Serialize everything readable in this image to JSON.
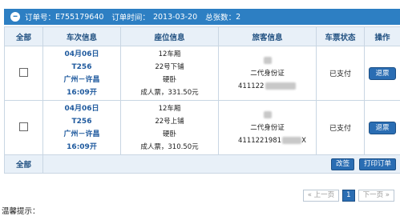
{
  "order": {
    "label_no": "订单号：",
    "no": "E755179640",
    "label_time": "订单时间：",
    "time": "2013-03-20",
    "label_count": "总张数：",
    "count": "2",
    "icon": "minus-circle-icon"
  },
  "columns": [
    "全部",
    "车次信息",
    "座位信息",
    "旅客信息",
    "车票状态",
    "操作"
  ],
  "rows": [
    {
      "date": "04月06日",
      "train": "T256",
      "route": "广州－许昌",
      "depart": "16:09开",
      "car": "12车厢",
      "seat": "22号下铺",
      "class": "硬卧",
      "fare": "成人票，331.50元",
      "id_type": "二代身份证",
      "id_no": "411122",
      "status": "已支付",
      "action": "退票"
    },
    {
      "date": "04月06日",
      "train": "T256",
      "route": "广州－许昌",
      "depart": "16:09开",
      "car": "12车厢",
      "seat": "22号上铺",
      "class": "硬卧",
      "fare": "成人票，310.50元",
      "id_type": "二代身份证",
      "id_no": "4111221981",
      "id_suffix": "X",
      "status": "已支付",
      "action": "退票"
    }
  ],
  "footer": {
    "all": "全部",
    "change": "改签",
    "print": "打印订单"
  },
  "pager": {
    "prev": "上一页",
    "current": "1",
    "next": "下一页"
  },
  "tip": "温馨提示："
}
